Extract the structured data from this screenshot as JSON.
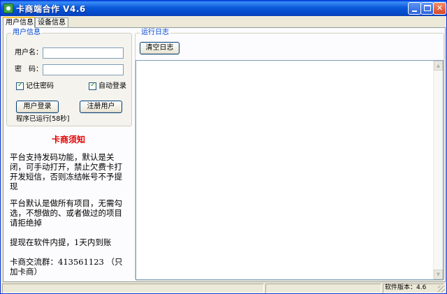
{
  "window": {
    "title": "卡商端合作 V4.6"
  },
  "tabs": [
    {
      "label": "用户信息"
    },
    {
      "label": "设备信息"
    }
  ],
  "user_info": {
    "group_label": "用户信息",
    "username_label": "用户名：",
    "username_value": "",
    "password_label": "密　码：",
    "password_value": "",
    "remember_password_label": "记住密码",
    "remember_password_checked": true,
    "auto_login_label": "自动登录",
    "auto_login_checked": true,
    "login_button": "用户登录",
    "register_button": "注册用户",
    "uptime_text": "程序已运行[58秒]"
  },
  "notice": {
    "title": "卡商须知",
    "paragraphs": [
      "平台支持发码功能，默认是关闭，可手动打开，禁止欠费卡打开发短信，否则冻结帐号不予提现",
      "平台默认是做所有项目，无需勾选，不想做的、或者做过的项目请拒绝掉",
      "提现在软件内提，1天内到账",
      "卡商交流群：413561123 （只加卡商）"
    ]
  },
  "log": {
    "group_label": "运行日志",
    "clear_button": "清空日志"
  },
  "statusbar": {
    "version": "软件版本：4.6"
  },
  "colors": {
    "titlebar": "#0a58d8",
    "notice_title": "#e00000",
    "group_label": "#0046d5"
  }
}
